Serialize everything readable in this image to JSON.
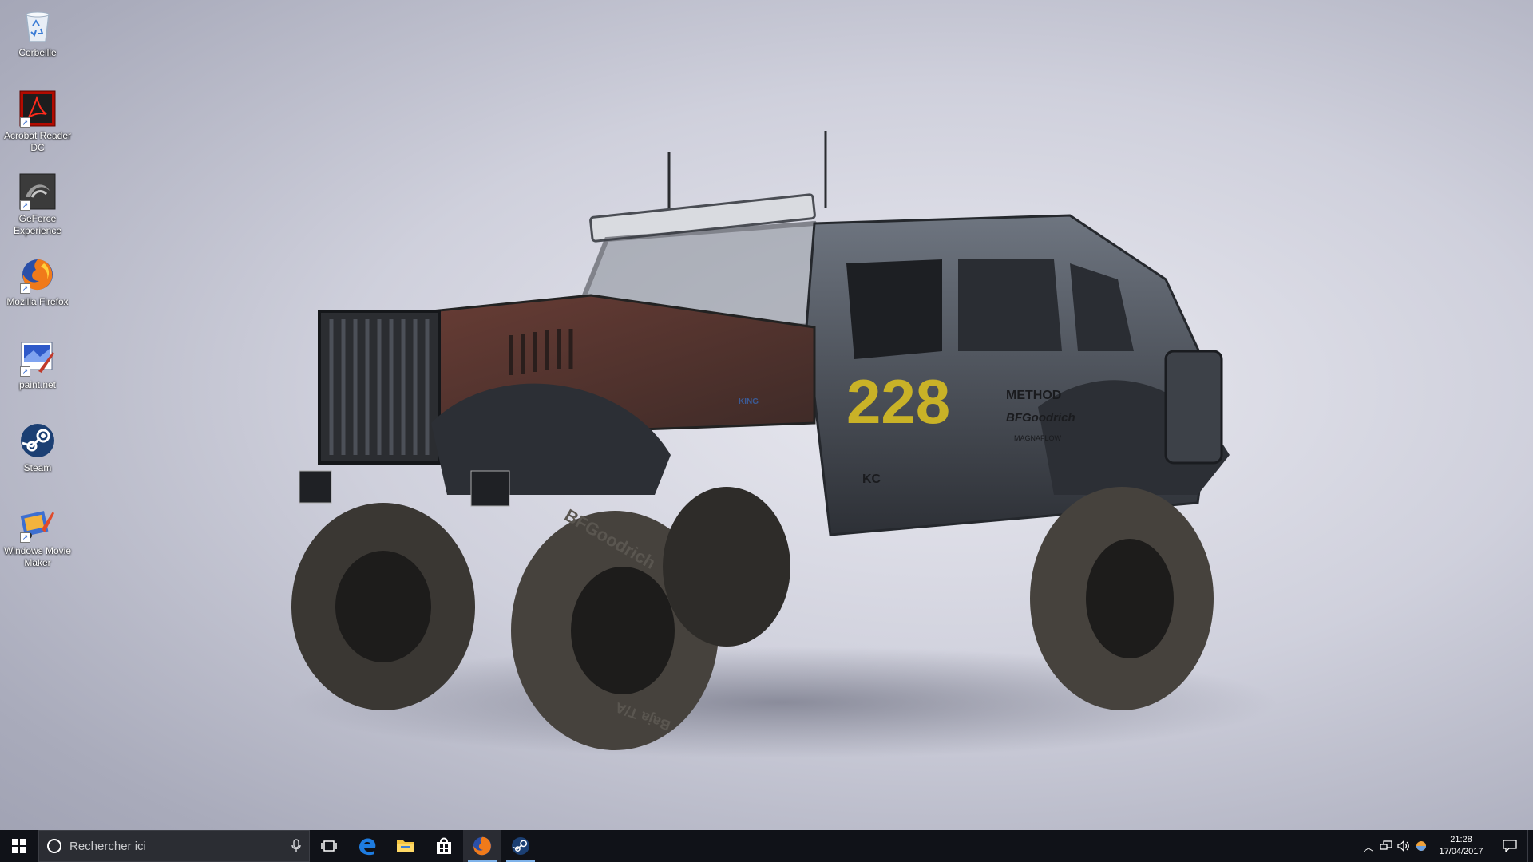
{
  "desktop": {
    "icons": [
      {
        "label": "Corbeille",
        "icon": "recycle-bin-icon"
      },
      {
        "label": "Acrobat Reader DC",
        "icon": "acrobat-icon"
      },
      {
        "label": "GeForce Experience",
        "icon": "geforce-icon"
      },
      {
        "label": "Mozilla Firefox",
        "icon": "firefox-icon"
      },
      {
        "label": "paint.net",
        "icon": "paintnet-icon"
      },
      {
        "label": "Steam",
        "icon": "steam-icon"
      },
      {
        "label": "Windows Movie Maker",
        "icon": "movie-maker-icon"
      }
    ]
  },
  "wallpaper": {
    "car_number": "228",
    "decals": [
      "METHOD",
      "BFGoodrich",
      "MAGNAFLOW",
      "KC",
      "KING"
    ],
    "tire_text": "BFGoodrich",
    "tire_text_2": "Baja T/A"
  },
  "taskbar": {
    "search_placeholder": "Rechercher ici",
    "pinned": [
      {
        "name": "task-view",
        "icon": "task-view-icon"
      },
      {
        "name": "edge",
        "icon": "edge-icon"
      },
      {
        "name": "file-explorer",
        "icon": "folder-icon"
      },
      {
        "name": "store",
        "icon": "store-icon"
      },
      {
        "name": "firefox",
        "icon": "firefox-icon",
        "running": true
      },
      {
        "name": "steam",
        "icon": "steam-icon",
        "running": true
      }
    ],
    "clock": {
      "time": "21:28",
      "date": "17/04/2017"
    }
  },
  "colors": {
    "taskbar_bg": "#101218",
    "accent": "#7fb3ea",
    "desktop_bg": "#c6c7d3"
  }
}
